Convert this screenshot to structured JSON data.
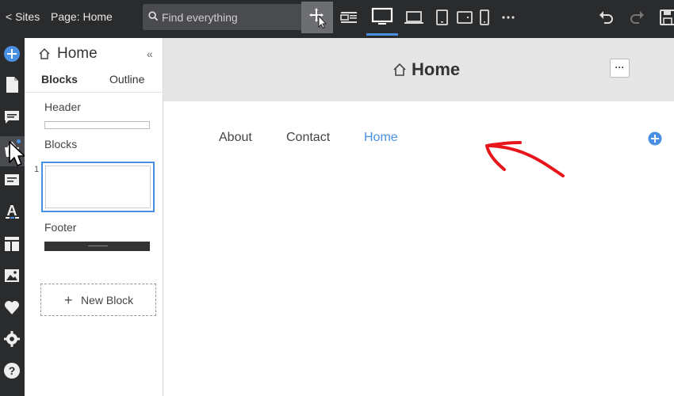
{
  "topbar": {
    "sites_link": "< Sites",
    "page_label": "Page: Home",
    "search_placeholder": "Find everything",
    "icons": [
      "move-icon",
      "layout-icon",
      "desktop-icon",
      "laptop-icon",
      "tablet-landscape-icon",
      "tablet-portrait-icon",
      "phone-icon",
      "more-icon",
      "undo-icon",
      "redo-icon",
      "save-icon"
    ]
  },
  "rail": {
    "icons": [
      "add-icon",
      "pages-icon",
      "comments-icon",
      "store-icon",
      "forms-icon",
      "text-icon",
      "layout-icon",
      "image-icon",
      "heart-icon",
      "settings-icon",
      "help-icon"
    ],
    "active": "store-icon"
  },
  "panel": {
    "title": "Home",
    "collapse": "«",
    "tabs": [
      "Blocks",
      "Outline"
    ],
    "active_tab": "Blocks",
    "header_label": "Header",
    "blocks_label": "Blocks",
    "block_number": "1",
    "footer_label": "Footer",
    "new_block": "New Block"
  },
  "canvas": {
    "page_title": "Home",
    "more": "···",
    "nav": [
      "About",
      "Contact",
      "Home"
    ],
    "active_nav": "Home"
  },
  "colors": {
    "dark": "#2a2b2d",
    "accent": "#4a90e2",
    "annotation": "#e8161b"
  }
}
